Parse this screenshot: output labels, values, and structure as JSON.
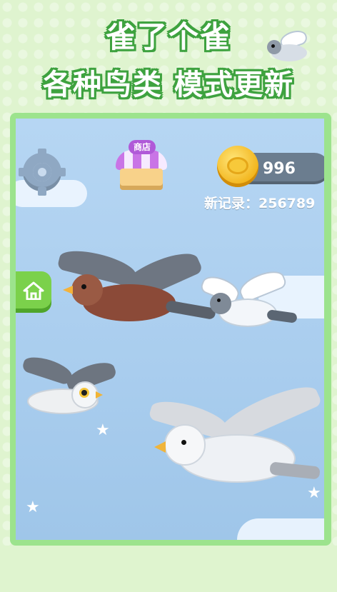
{
  "header": {
    "title_line1": "雀了个雀",
    "title_line2": "各种鸟类 模式更新"
  },
  "hud": {
    "shop_label": "商店",
    "coins": "996",
    "record_label": "新记录：",
    "record_value": "256789"
  },
  "icons": {
    "settings": "gear-icon",
    "home": "home-icon",
    "coin": "coin-icon"
  },
  "colors": {
    "accent_green": "#3ea23f",
    "frame_green": "#9ce38d",
    "sky": "#b6d6f3",
    "coin_gold": "#f2b41b",
    "shop_purple": "#b05ad8"
  }
}
